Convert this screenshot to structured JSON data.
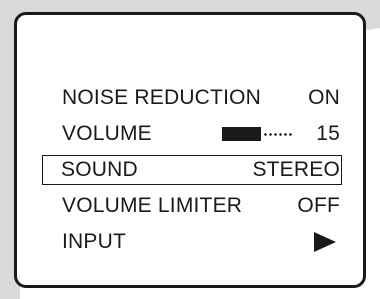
{
  "menu": {
    "items": [
      {
        "label": "NOISE REDUCTION",
        "value": "ON",
        "selected": false
      },
      {
        "label": "VOLUME",
        "value": "15",
        "selected": false,
        "level_fraction": 0.55
      },
      {
        "label": "SOUND",
        "value": "STEREO",
        "selected": true
      },
      {
        "label": "VOLUME LIMITER",
        "value": "OFF",
        "selected": false
      },
      {
        "label": "INPUT",
        "value": "",
        "selected": false,
        "icon": "play-right-arrow-icon"
      }
    ]
  },
  "colors": {
    "text": "#1a1a1a",
    "backdrop": "#d9d9d9",
    "frame": "#1a1a1a"
  }
}
